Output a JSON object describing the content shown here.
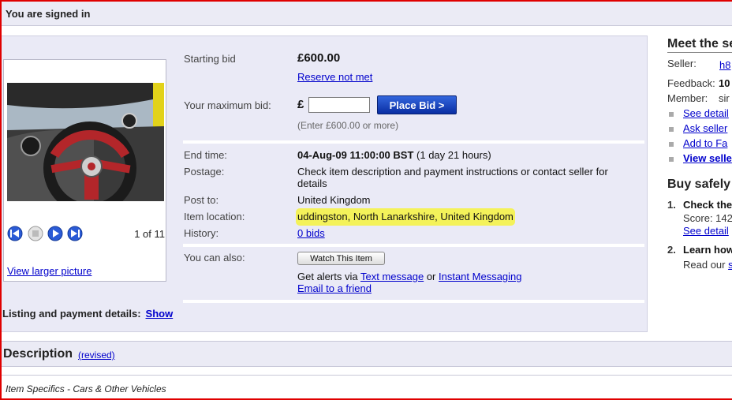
{
  "signed_in": "You are signed in",
  "picture": {
    "count": "1 of 11",
    "view_larger": "View larger picture"
  },
  "bid": {
    "starting_label": "Starting bid",
    "starting_value": "£600.00",
    "reserve": "Reserve not met",
    "max_label": "Your maximum bid:",
    "currency": "£",
    "input_value": "",
    "place_bid": "Place Bid >",
    "hint": "(Enter £600.00 or more)"
  },
  "details": {
    "end_label": "End time:",
    "end_value": "04-Aug-09 11:00:00 BST",
    "end_remaining": "(1 day 21 hours)",
    "postage_label": "Postage:",
    "postage_value": "Check item description and payment instructions or contact seller for details",
    "post_to_label": "Post to:",
    "post_to_value": "United Kingdom",
    "location_label": "Item location:",
    "location_value": "uddingston, North Lanarkshire, United Kingdom",
    "history_label": "History:",
    "history_value": "0 bids"
  },
  "also": {
    "label": "You can also:",
    "watch": "Watch This Item",
    "alerts_prefix": "Get alerts via",
    "text_message": "Text message",
    "or": "or",
    "instant_messaging": "Instant Messaging",
    "email_friend": "Email to a friend"
  },
  "listing": {
    "label": "Listing and payment details:",
    "show": "Show"
  },
  "description": {
    "title": "Description",
    "revised": "(revised)",
    "specifics": "Item Specifics - Cars & Other Vehicles"
  },
  "seller": {
    "heading": "Meet the se",
    "seller_label": "Seller:",
    "seller_value": "h8",
    "feedback_label": "Feedback:",
    "feedback_value": "10",
    "member_label": "Member:",
    "member_value": "sir",
    "links": [
      "See detail",
      "Ask seller",
      "Add to Fa",
      "View selle"
    ]
  },
  "safety": {
    "heading": "Buy safely",
    "item1_num": "1.",
    "item1_title": "Check the",
    "item1_score": "Score: 142",
    "item1_link": "See detail",
    "item2_num": "2.",
    "item2_title": "Learn how",
    "item2_text": "Read our",
    "item2_link": "s"
  },
  "colors": {
    "accent_button": "#0a2ea3",
    "highlight": "#f4f25a",
    "panel": "#eaeaf6",
    "frame": "#e00000"
  }
}
